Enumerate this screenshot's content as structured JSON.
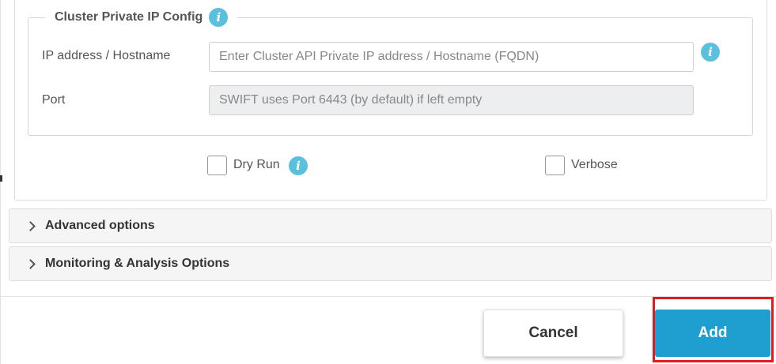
{
  "cluster_private_ip": {
    "legend": "Cluster Private IP Config",
    "legend_icon": "info-icon",
    "ip_label": "IP address / Hostname",
    "ip_value": "",
    "ip_placeholder": "Enter Cluster API Private IP address / Hostname (FQDN)",
    "ip_icon": "info-icon",
    "port_label": "Port",
    "port_value": "",
    "port_placeholder": "SWIFT uses Port 6443 (by default) if left empty"
  },
  "options": {
    "dry_run_label": "Dry Run",
    "dry_run_checked": false,
    "dry_run_icon": "info-icon",
    "verbose_label": "Verbose",
    "verbose_checked": false
  },
  "sections": {
    "advanced": "Advanced options",
    "monitoring": "Monitoring & Analysis Options"
  },
  "footer": {
    "cancel_label": "Cancel",
    "add_label": "Add"
  },
  "colors": {
    "accent": "#1f9fd0",
    "info_icon": "#5bc0de",
    "highlight": "#e11b22"
  },
  "icons": {
    "info": "i"
  }
}
